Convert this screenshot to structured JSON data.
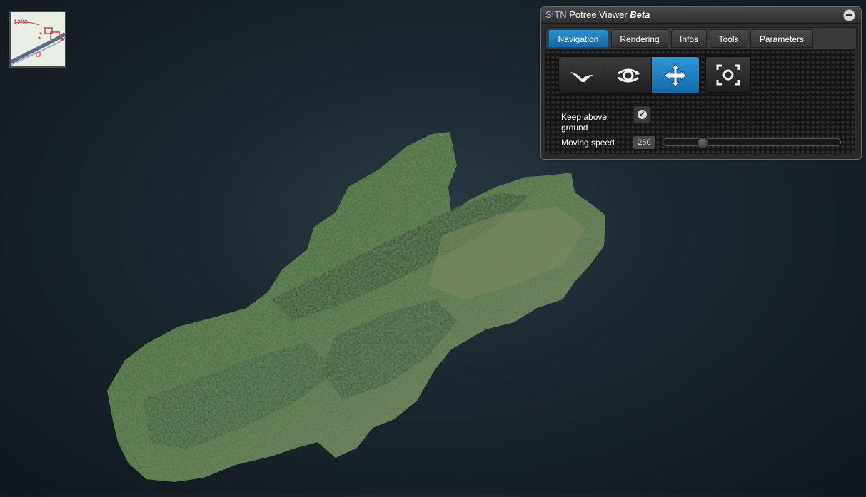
{
  "title": {
    "brand": "SITN",
    "name": "Potree Viewer",
    "badge": "Beta"
  },
  "tabs": [
    {
      "label": "Navigation",
      "active": true
    },
    {
      "label": "Rendering",
      "active": false
    },
    {
      "label": "Infos",
      "active": false
    },
    {
      "label": "Tools",
      "active": false
    },
    {
      "label": "Parameters",
      "active": false
    }
  ],
  "navigation": {
    "modes": [
      {
        "icon": "flight-mode-icon",
        "active": false
      },
      {
        "icon": "orbit-mode-icon",
        "active": false
      },
      {
        "icon": "pan-mode-icon",
        "active": true
      }
    ],
    "focus_icon": "focus-extent-icon",
    "keep_above_ground_label_line1": "Keep above",
    "keep_above_ground_label_line2": "ground",
    "keep_above_ground_checked": true,
    "moving_speed_label": "Moving speed",
    "moving_speed_value": "250",
    "moving_speed_fraction": 0.2
  },
  "minimap": {
    "label": "1290"
  },
  "colors": {
    "accent": "#1f7fbf",
    "panel_bg": "#2b2b2b"
  }
}
